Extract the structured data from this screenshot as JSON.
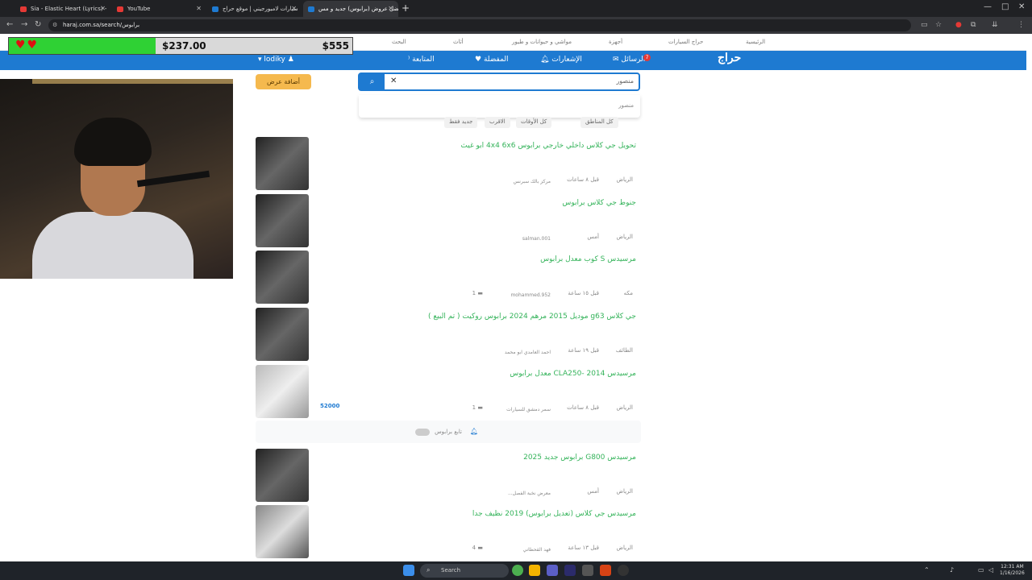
{
  "tabs": [
    {
      "label": "Sia - Elastic Heart (Lyrics) - ",
      "color": "#e53935",
      "active": false
    },
    {
      "label": "YouTube",
      "color": "#e53935",
      "active": false
    },
    {
      "label": "سيارات لامبورجيني | موقع حراج",
      "color": "#1e7ad1",
      "active": false
    },
    {
      "label": "افضل عروض (برابوس) جديد و مس",
      "color": "#1e7ad1",
      "active": true
    }
  ],
  "url": "haraj.com.sa/search/برابوس",
  "topnav": [
    "الرئيسية",
    "حراج السيارات",
    "أجهزة",
    "مواشي و حيوانات و طيور",
    "أثاث",
    "البحث"
  ],
  "bluenav": {
    "logo": "حراج",
    "messages": "الرسائل",
    "messages_badge": "7",
    "notifications": "الإشعارات",
    "favorites": "المفضلة",
    "following": "المتابعة",
    "user": "lodiky"
  },
  "overlay": {
    "amount_current": "$237.00",
    "amount_goal": "$555",
    "progress": 0.427
  },
  "add_offer": "أضافة عرض",
  "search": {
    "value": "منصور",
    "suggestion": "منصور"
  },
  "filters": [
    "كل المناطق",
    "كل الأوقات",
    "الاقرب",
    "جديد فقط"
  ],
  "listings": [
    {
      "title": "تحويل جي كلاس داخلي خارجي برابوس 4x4 6x6 ابو غيث",
      "city": "الرياض",
      "time": "قبل ٨ ساعات",
      "user": "مركز بالك سبرنس",
      "count": "",
      "price": ""
    },
    {
      "title": "جنوط جي كلاس برابوس",
      "city": "الرياض",
      "time": "أمس",
      "user": "salman.001",
      "count": "",
      "price": ""
    },
    {
      "title": "مرسيدس S كوب معدل برابوس",
      "city": "مكه",
      "time": "قبل ١٥ ساعة",
      "user": "mohammed.952",
      "count": "1",
      "price": ""
    },
    {
      "title": "جي كلاس g63 موديل 2015 مرهم 2024 برابوس روكيت ( تم البيع )",
      "city": "الطائف",
      "time": "قبل ١٩ ساعة",
      "user": "احمد العامدي ابو محمد",
      "count": "",
      "price": ""
    },
    {
      "title": "مرسيدس 2014 -CLA250 معدل برابوس",
      "city": "الرياض",
      "time": "قبل ٨ ساعات",
      "user": "سمر دمشق للسيارات",
      "count": "1",
      "price": "52000"
    },
    {
      "title": "مرسيدس G800 برابوس جديد 2025",
      "city": "الرياض",
      "time": "أمس",
      "user": "معرض نخبة الفصل...",
      "count": "",
      "price": ""
    },
    {
      "title": "مرسيدس جي كلاس (تعديل برابوس) 2019 نظيف جدا",
      "city": "الرياض",
      "time": "قبل ١٣ ساعة",
      "user": "فهد القحطاني",
      "count": "4",
      "price": ""
    }
  ],
  "follow_label": "تابع برابوس",
  "taskbar": {
    "search": "Search",
    "time": "12:31 AM",
    "date": "1/16/2026"
  }
}
